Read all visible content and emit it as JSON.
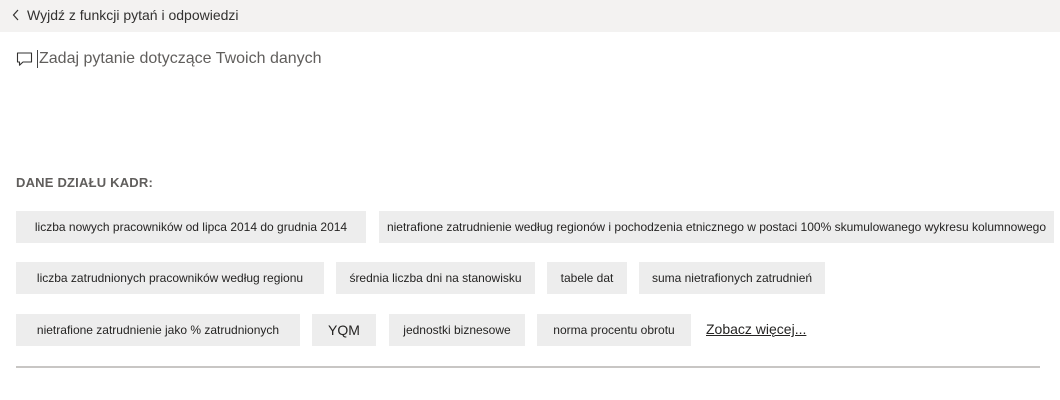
{
  "header": {
    "back_label": "Wyjdź z funkcji pytań i odpowiedzi",
    "back_icon": "chevron-left-icon"
  },
  "question": {
    "placeholder": "Zadaj pytanie dotyczące Twoich danych",
    "value": "",
    "icon": "chat-bubble-icon"
  },
  "suggestions": {
    "section_label": "DANE DZIAŁU KADR:",
    "items": [
      "liczba nowych pracowników od lipca 2014 do grudnia 2014",
      "nietrafione zatrudnienie według regionów i pochodzenia etnicznego w postaci 100% skumulowanego wykresu kolumnowego",
      "liczba zatrudnionych pracowników według regionu",
      "średnia liczba dni na stanowisku",
      "tabele dat",
      "suma nietrafionych zatrudnień",
      "nietrafione zatrudnienie jako % zatrudnionych",
      "YQM",
      "jednostki biznesowe",
      "norma procentu obrotu"
    ],
    "see_more_label": "Zobacz więcej..."
  },
  "colors": {
    "topbar_bg": "#f3f2f1",
    "chip_bg": "#ededed",
    "text": "#252423",
    "muted_text": "#605e5c",
    "divider": "#c8c6c4"
  }
}
